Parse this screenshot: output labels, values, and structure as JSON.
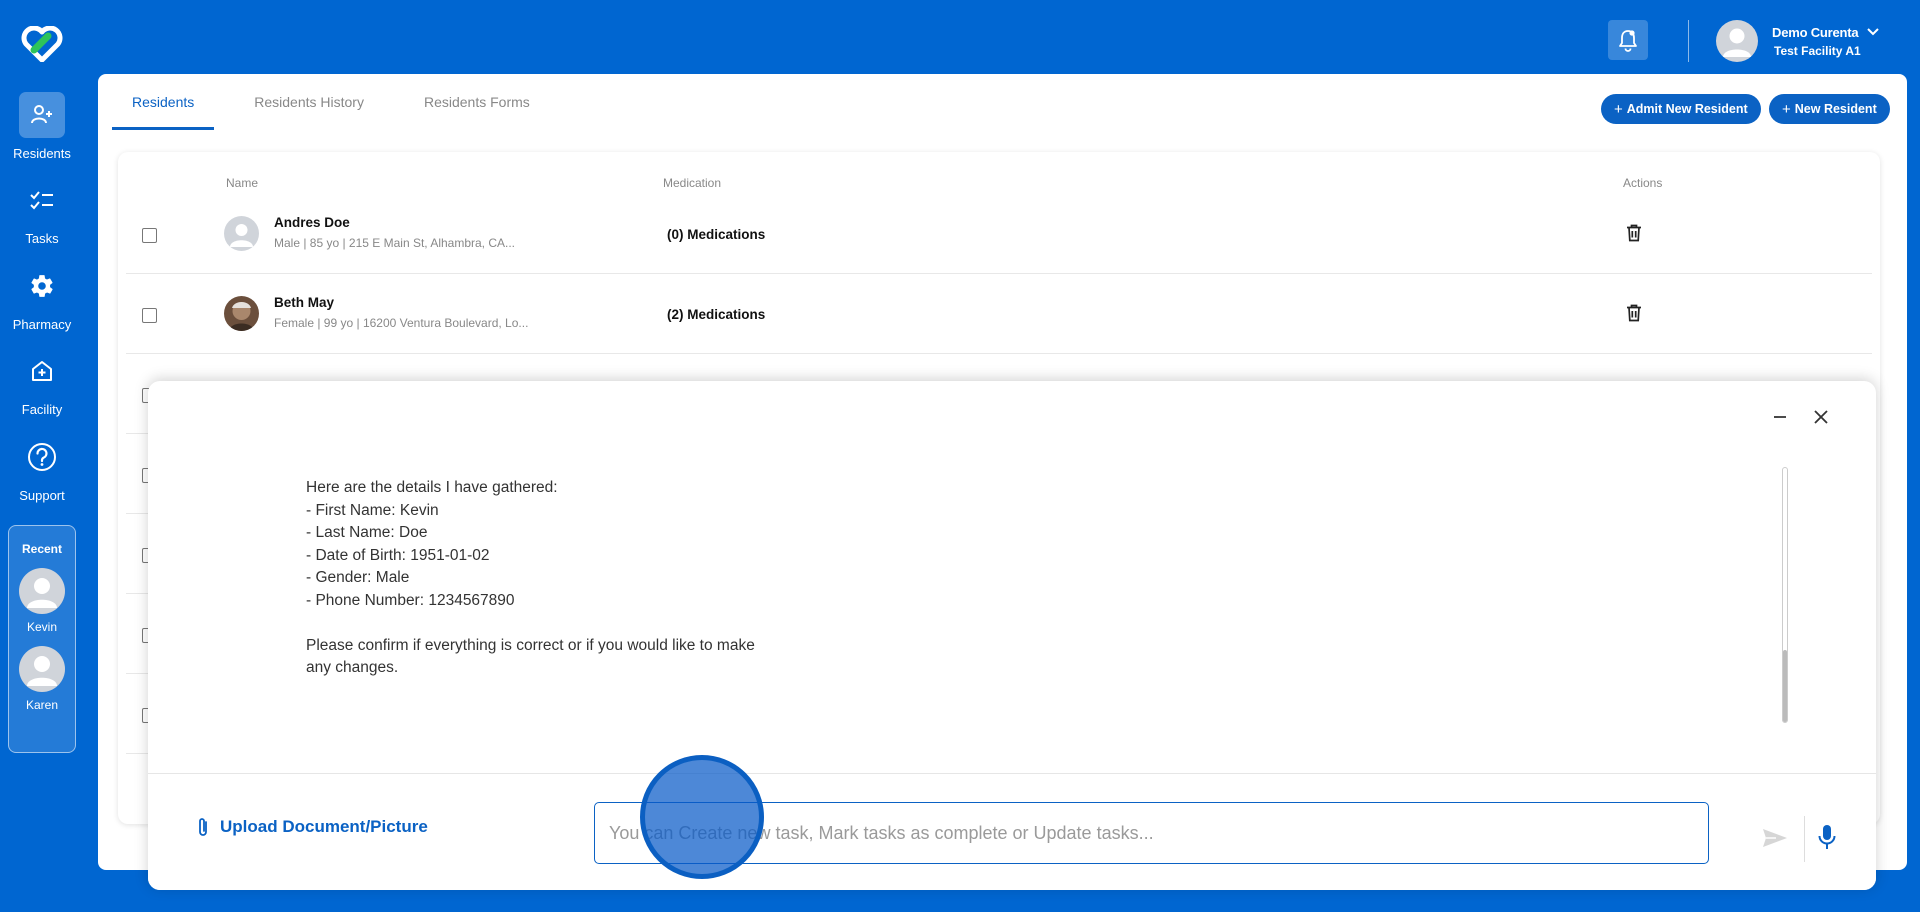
{
  "sidebar": {
    "items": [
      {
        "label": "Residents",
        "icon": "residents-icon"
      },
      {
        "label": "Tasks",
        "icon": "tasks-icon"
      },
      {
        "label": "Pharmacy",
        "icon": "gear-icon"
      },
      {
        "label": "Facility",
        "icon": "facility-icon"
      },
      {
        "label": "Support",
        "icon": "help-icon"
      }
    ],
    "recent": {
      "title": "Recent",
      "people": [
        {
          "name": "Kevin"
        },
        {
          "name": "Karen"
        }
      ]
    }
  },
  "header": {
    "user_name": "Demo Curenta",
    "facility": "Test Facility A1"
  },
  "tabs": [
    {
      "label": "Residents"
    },
    {
      "label": "Residents History"
    },
    {
      "label": "Residents Forms"
    }
  ],
  "actions": {
    "admit_label": "Admit New Resident",
    "new_label": "New Resident"
  },
  "table": {
    "columns": {
      "name": "Name",
      "medication": "Medication",
      "actions": "Actions"
    },
    "rows": [
      {
        "name": "Andres Doe",
        "details": "Male | 85 yo | 215 E Main St, Alhambra, CA...",
        "medications": "(0) Medications"
      },
      {
        "name": "Beth May",
        "details": "Female | 99 yo | 16200 Ventura Boulevard, Lo...",
        "medications": "(2) Medications"
      }
    ]
  },
  "chat": {
    "message": "Here are the details I have gathered:\n- First Name: Kevin\n- Last Name: Doe\n- Date of Birth: 1951-01-02\n- Gender: Male\n- Phone Number: 1234567890\n\nPlease confirm if everything is correct or if you would like to make any changes.",
    "upload_label": "Upload Document/Picture",
    "input_placeholder": "You can Create new task, Mark tasks as complete or Update tasks...",
    "input_value": ""
  },
  "colors": {
    "brand_blue": "#0066d1",
    "accent": "#0b62c4"
  }
}
